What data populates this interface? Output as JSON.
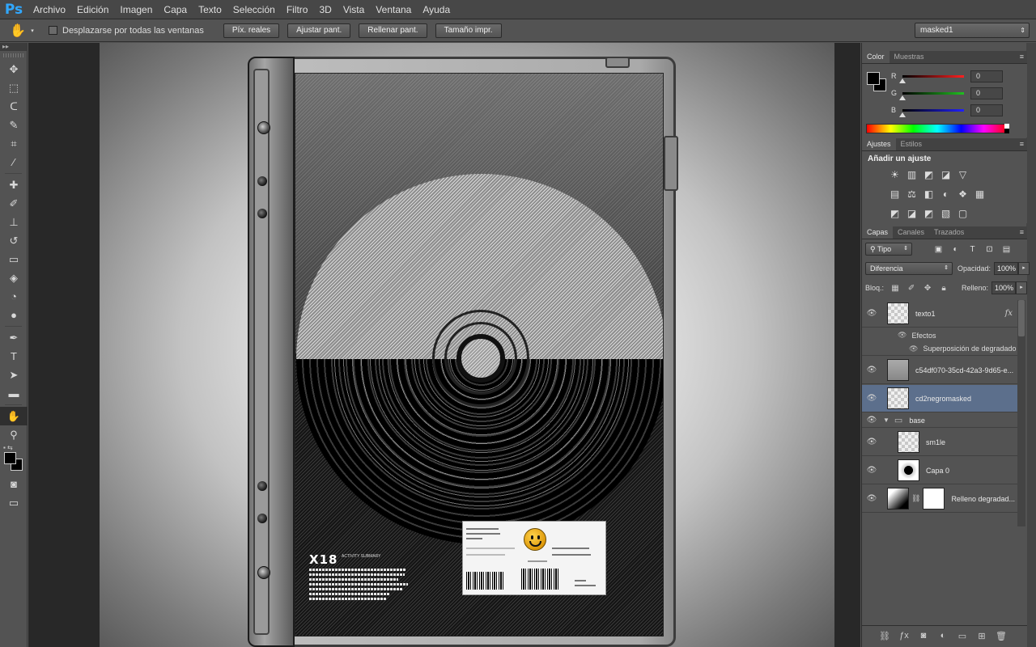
{
  "app": {
    "logo": "Ps"
  },
  "menu": [
    "Archivo",
    "Edición",
    "Imagen",
    "Capa",
    "Texto",
    "Selección",
    "Filtro",
    "3D",
    "Vista",
    "Ventana",
    "Ayuda"
  ],
  "options": {
    "scroll_all_label": "Desplazarse por todas las ventanas",
    "buttons": [
      "Píx. reales",
      "Ajustar pant.",
      "Rellenar pant.",
      "Tamaño impr."
    ],
    "workspace": "masked1"
  },
  "tools": [
    "move",
    "marquee",
    "lasso",
    "quick-select",
    "crop",
    "eyedropper",
    "spot-heal",
    "brush",
    "clone-stamp",
    "history-brush",
    "eraser",
    "paint-bucket",
    "blur",
    "dodge",
    "pen",
    "type",
    "path-select",
    "rectangle",
    "hand",
    "zoom"
  ],
  "float_panel": {
    "items": [
      "¶",
      "A|",
      "⊞"
    ]
  },
  "color_panel": {
    "tabs": [
      "Color",
      "Muestras"
    ],
    "sliders": [
      {
        "label": "R",
        "value": "0",
        "color": "#ff2020"
      },
      {
        "label": "G",
        "value": "0",
        "color": "#20c020"
      },
      {
        "label": "B",
        "value": "0",
        "color": "#2020ff"
      }
    ]
  },
  "adjustments_panel": {
    "tabs": [
      "Ajustes",
      "Estilos"
    ],
    "title": "Añadir un ajuste"
  },
  "layers_panel": {
    "tabs": [
      "Capas",
      "Canales",
      "Trazados"
    ],
    "filter_kind": "Tipo",
    "blend_mode": "Diferencia",
    "opacity_label": "Opacidad:",
    "opacity": "100%",
    "lock_label": "Bloq.:",
    "fill_label": "Relleno:",
    "fill": "100%",
    "layers": [
      {
        "name": "texto1",
        "thumb": "checker",
        "fx": "fx",
        "selected": false
      },
      {
        "name": "c54df070-35cd-42a3-9d65-e...",
        "thumb": "checker",
        "selected": false
      },
      {
        "name": "cd2negromasked",
        "thumb": "checker",
        "selected": true
      },
      {
        "name": "base",
        "thumb": "folder",
        "selected": false
      },
      {
        "name": "sm1le",
        "thumb": "checker",
        "selected": false
      },
      {
        "name": "Capa 0",
        "thumb": "checker",
        "selected": false
      },
      {
        "name": "Relleno degradad...",
        "thumb": "gradient",
        "selected": false
      }
    ],
    "effects_label": "Efectos",
    "effect_name": "Superposición de degradado"
  },
  "artwork": {
    "logo": "X18",
    "logo_sub": "ACTIVITY SUBMARY"
  }
}
